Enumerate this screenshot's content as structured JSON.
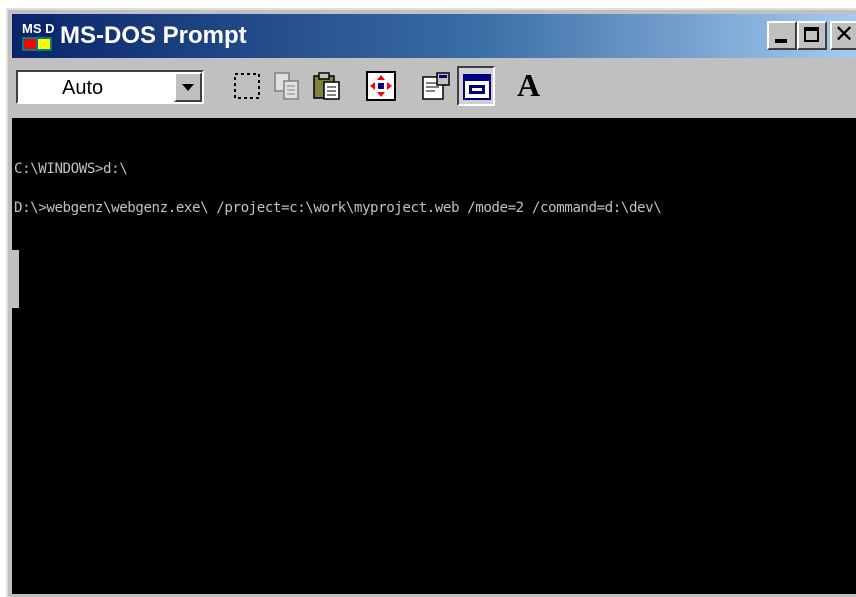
{
  "window": {
    "title": "MS-DOS Prompt",
    "icon": "ms-dos-icon",
    "icon_text": "MS DOS"
  },
  "controls": {
    "minimize_icon": "minimize-icon",
    "maximize_icon": "maximize-icon",
    "close_icon": "close-icon",
    "close_glyph": "✕"
  },
  "toolbar": {
    "font_size_value": "Auto",
    "buttons": [
      {
        "name": "mark-icon"
      },
      {
        "name": "copy-icon"
      },
      {
        "name": "paste-icon"
      },
      {
        "name": "full-screen-icon"
      },
      {
        "name": "properties-icon"
      },
      {
        "name": "background-icon",
        "pressed": true
      },
      {
        "name": "font-icon",
        "glyph": "A"
      }
    ]
  },
  "console": {
    "lines": [
      "C:\\WINDOWS>d:\\",
      "D:\\>webgenz\\webgenz.exe\\ /project=c:\\work\\myproject.web /mode=2 /command=d:\\dev\\"
    ]
  },
  "colors": {
    "title_start": "#0a246a",
    "title_end": "#a6caf0",
    "console_bg": "#000000",
    "console_text": "#c0c0c0",
    "chrome": "#c0c0c0"
  }
}
